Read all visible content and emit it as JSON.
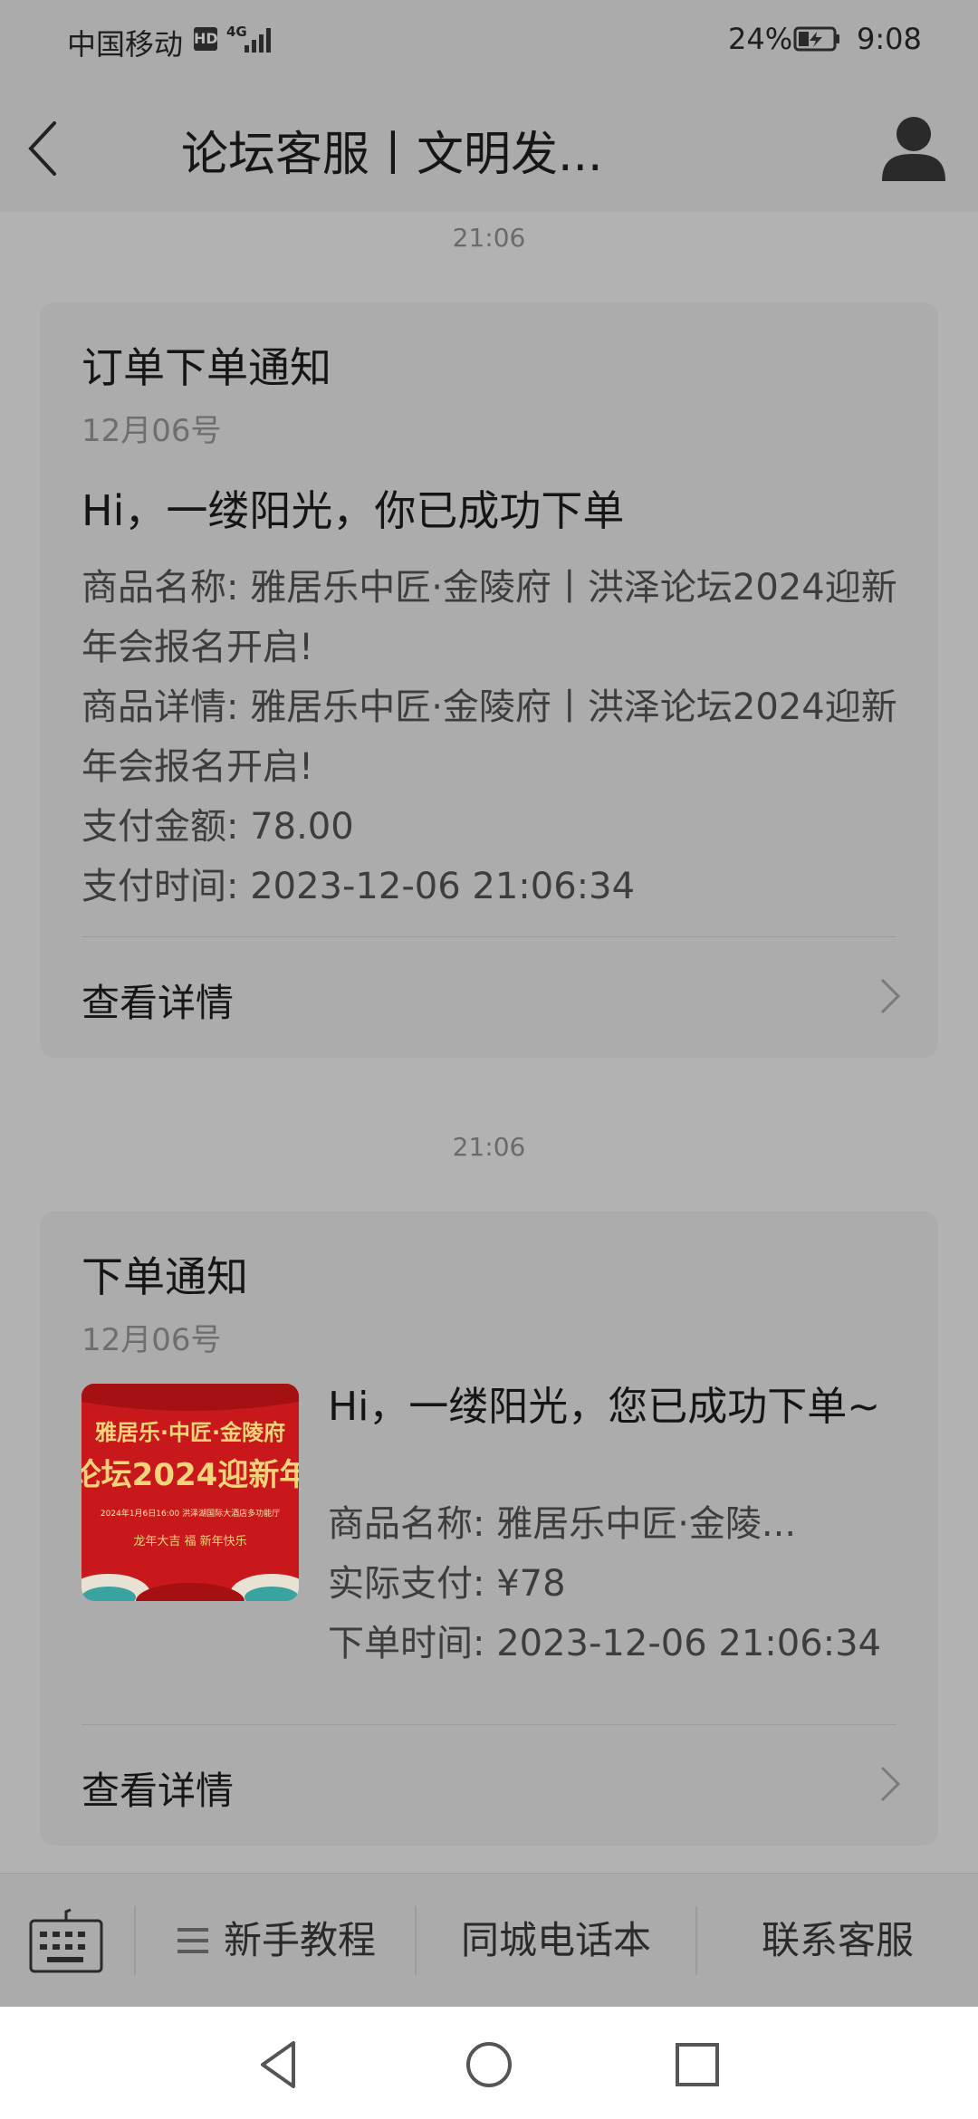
{
  "status_bar": {
    "carrier": "中国移动",
    "hd_badge": "HD",
    "network": "4G",
    "battery_percent": "24%",
    "time": "9:08"
  },
  "header": {
    "title": "论坛客服丨文明发..."
  },
  "messages": [
    {
      "timestamp": "21:06",
      "card": {
        "title": "订单下单通知",
        "date": "12月06号",
        "greeting": "Hi，一缕阳光，你已成功下单",
        "lines": [
          "商品名称: 雅居乐中匠·金陵府丨洪泽论坛2024迎新年会报名开启!",
          "商品详情: 雅居乐中匠·金陵府丨洪泽论坛2024迎新年会报名开启!",
          "支付金额: 78.00",
          "支付时间: 2023-12-06 21:06:34"
        ],
        "link_label": "查看详情"
      }
    },
    {
      "timestamp": "21:06",
      "card": {
        "title": "下单通知",
        "date": "12月06号",
        "greeting": "Hi，一缕阳光，您已成功下单~",
        "lines": [
          "商品名称: 雅居乐中匠·金陵...",
          "实际支付: ¥78",
          "下单时间: 2023-12-06 21:06:34"
        ],
        "thumbnail": {
          "line1": "雅居乐·中匠·金陵府",
          "line2": "论坛2024迎新年",
          "line3": "2024年1月6日16:00  洪泽湖国际大酒店多功能厅",
          "line4": "龙年大吉  福  新年快乐"
        },
        "link_label": "查看详情"
      }
    }
  ],
  "bottom_menu": {
    "items": [
      "新手教程",
      "同城电话本",
      "联系客服"
    ]
  },
  "colors": {
    "thumbnail_red": "#c8181b",
    "thumbnail_gold": "#f5d37a"
  },
  "icons": {
    "back": "chevron-left-icon",
    "profile": "person-icon",
    "keyboard": "keyboard-icon",
    "menu": "hamburger-icon",
    "detail": "chevron-right-icon"
  }
}
